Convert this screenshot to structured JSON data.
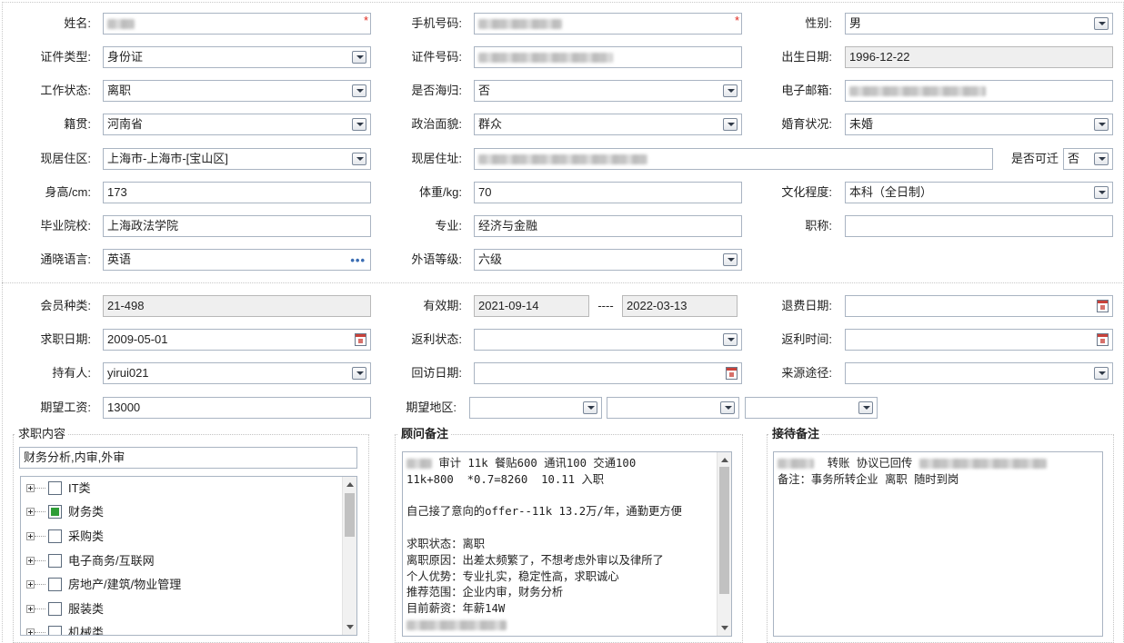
{
  "form": {
    "name_label": "姓名:",
    "phone_label": "手机号码:",
    "gender_label": "性别:",
    "gender_value": "男",
    "id_type_label": "证件类型:",
    "id_type_value": "身份证",
    "id_no_label": "证件号码:",
    "birth_label": "出生日期:",
    "birth_value": "1996-12-22",
    "work_status_label": "工作状态:",
    "work_status_value": "离职",
    "returnee_label": "是否海归:",
    "returnee_value": "否",
    "email_label": "电子邮箱:",
    "native_label": "籍贯:",
    "native_value": "河南省",
    "political_label": "政治面貌:",
    "political_value": "群众",
    "marital_label": "婚育状况:",
    "marital_value": "未婚",
    "res_area_label": "现居住区:",
    "res_area_value": "上海市-上海市-[宝山区]",
    "res_addr_label": "现居住址:",
    "relocate_label": "是否可迁",
    "relocate_value": "否",
    "height_label": "身高/cm:",
    "height_value": "173",
    "weight_label": "体重/kg:",
    "weight_value": "70",
    "education_label": "文化程度:",
    "education_value": "本科（全日制）",
    "school_label": "毕业院校:",
    "school_value": "上海政法学院",
    "major_label": "专业:",
    "major_value": "经济与金融",
    "title_label": "职称:",
    "language_label": "通晓语言:",
    "language_value": "英语",
    "language_more": "•••",
    "lang_level_label": "外语等级:",
    "lang_level_value": "六级"
  },
  "membership": {
    "member_type_label": "会员种类:",
    "member_type_value": "21-498",
    "validity_label": "有效期:",
    "valid_from": "2021-09-14",
    "valid_sep": "----",
    "valid_to": "2022-03-13",
    "refund_date_label": "退费日期:",
    "job_date_label": "求职日期:",
    "job_date_value": "2009-05-01",
    "rebate_status_label": "返利状态:",
    "rebate_time_label": "返利时间:",
    "holder_label": "持有人:",
    "holder_value": "yirui021",
    "visit_date_label": "回访日期:",
    "source_label": "来源途径:",
    "salary_label": "期望工资:",
    "salary_value": "13000",
    "region_label": "期望地区:"
  },
  "job_content": {
    "title": "求职内容",
    "summary": "财务分析,内审,外审",
    "tree": [
      {
        "label": "IT类",
        "checked": false
      },
      {
        "label": "财务类",
        "checked": true
      },
      {
        "label": "采购类",
        "checked": false
      },
      {
        "label": "电子商务/互联网",
        "checked": false
      },
      {
        "label": "房地产/建筑/物业管理",
        "checked": false
      },
      {
        "label": "服装类",
        "checked": false
      },
      {
        "label": "机械类",
        "checked": false
      }
    ]
  },
  "advisor_notes": {
    "title": "顾问备注",
    "line1": " 审计 11k 餐贴600 通讯100 交通100",
    "line2": "11k+800  *0.7=8260  10.11 入职",
    "line3": "",
    "line4": "自己接了意向的offer--11k 13.2万/年，通勤更方便",
    "line5": "",
    "line6": "求职状态：离职",
    "line7": "离职原因：出差太频繁了，不想考虑外审以及律所了",
    "line8": "个人优势：专业扎实，稳定性高，求职诚心",
    "line9": "推荐范围：企业内审，财务分析",
    "line10": "目前薪资：年薪14W"
  },
  "reception_notes": {
    "title": "接待备注",
    "line1": "  转账 协议已回传",
    "line2": "备注：事务所转企业 离职 随时到岗"
  },
  "colors": {
    "required_star": "#e0281e",
    "readonly_bg": "#efefef",
    "checked_green": "#2f9d37"
  }
}
